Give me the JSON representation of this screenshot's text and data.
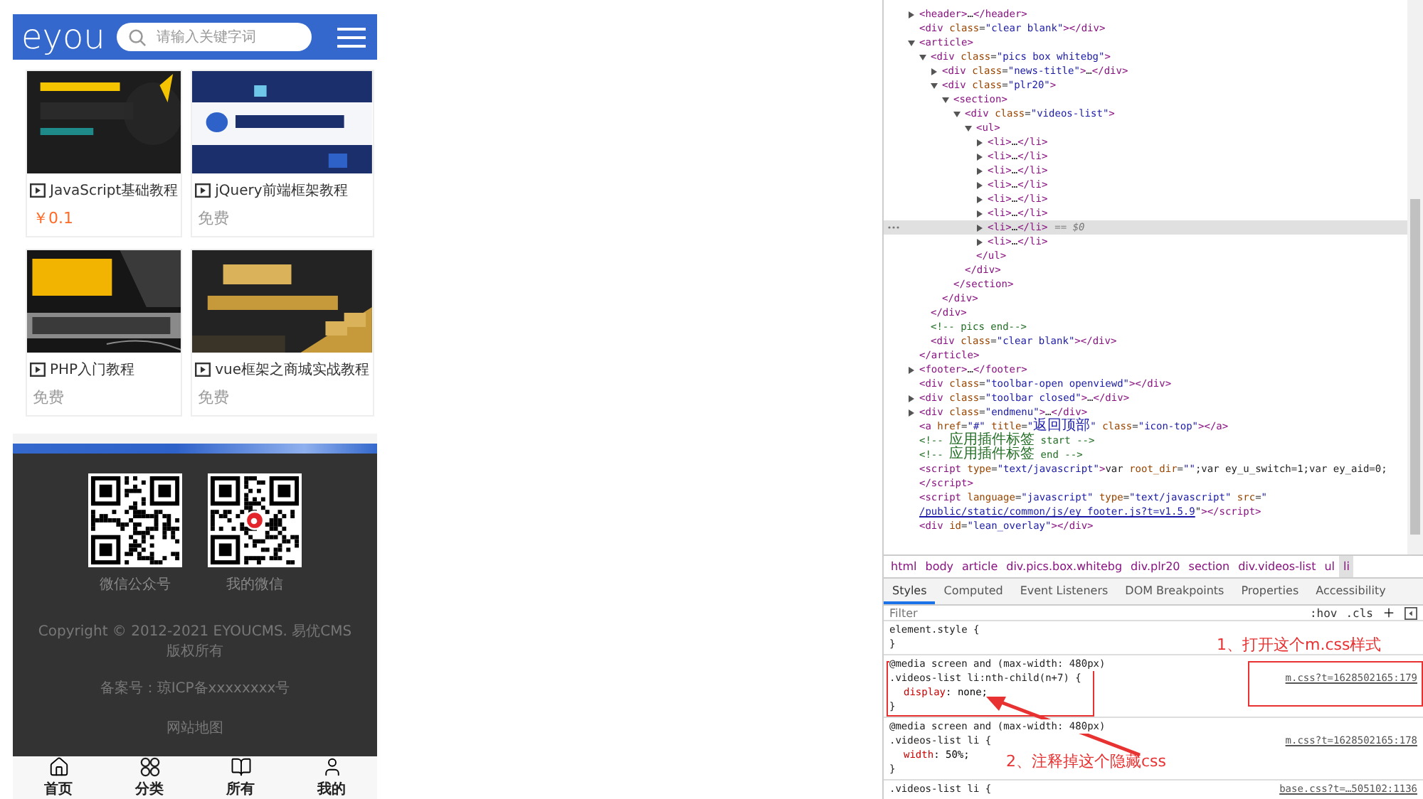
{
  "phone": {
    "logo": "eyou",
    "search": {
      "placeholder": "请输入关键字词"
    },
    "videos": [
      {
        "title": "JavaScript基础教程",
        "price": "￥0.1",
        "kind": "paid"
      },
      {
        "title": "jQuery前端框架教程",
        "price": "免费",
        "kind": "free"
      },
      {
        "title": "PHP入门教程",
        "price": "免费",
        "kind": "free"
      },
      {
        "title": "vue框架之商城实战教程",
        "price": "免费",
        "kind": "free"
      }
    ],
    "footer": {
      "qr_codes": [
        {
          "caption": "微信公众号",
          "badge": false
        },
        {
          "caption": "我的微信",
          "badge": true
        }
      ],
      "copyright": "Copyright © 2012-2021 EYOUCMS. 易优CMS 版权所有",
      "icp": "备案号：琼ICP备xxxxxxxx号",
      "sitemap": "网站地图"
    },
    "tabbar": [
      {
        "label": "首页",
        "kind": "home"
      },
      {
        "label": "分类",
        "kind": "grid"
      },
      {
        "label": "所有",
        "kind": "book"
      },
      {
        "label": "我的",
        "kind": "user"
      }
    ]
  },
  "devtools": {
    "dom_tree": [
      {
        "text": "<header>…</header>",
        "expanded": false
      },
      {
        "text": "<div class=\"clear blank\"></div>"
      },
      {
        "text": "<article>",
        "expanded": true,
        "closing": "</article>",
        "children": [
          {
            "text": "<div class=\"pics box whitebg\">",
            "expanded": true,
            "closing": "</div>",
            "children": [
              {
                "text": "<div class=\"news-title\">…</div>",
                "expanded": false
              },
              {
                "text": "<div class=\"plr20\">",
                "expanded": true,
                "closing": "</div>",
                "children": [
                  {
                    "text": "<section>",
                    "expanded": true,
                    "closing": "</section>",
                    "children": [
                      {
                        "text": "<div class=\"videos-list\">",
                        "expanded": true,
                        "closing": "</div>",
                        "children": [
                          {
                            "text": "<ul>",
                            "expanded": true,
                            "closing": "</ul>",
                            "children": [
                              {
                                "text": "<li>…</li>",
                                "expanded": false,
                                "selected": false
                              },
                              {
                                "text": "<li>…</li>",
                                "expanded": false,
                                "selected": false
                              },
                              {
                                "text": "<li>…</li>",
                                "expanded": false,
                                "selected": false
                              },
                              {
                                "text": "<li>…</li>",
                                "expanded": false,
                                "selected": false
                              },
                              {
                                "text": "<li>…</li>",
                                "expanded": false,
                                "selected": false
                              },
                              {
                                "text": "<li>…</li>",
                                "expanded": false,
                                "selected": false
                              },
                              {
                                "text": "<li>…</li>",
                                "expanded": false,
                                "selected": true,
                                "marker": "== $0"
                              },
                              {
                                "text": "<li>…</li>",
                                "expanded": false,
                                "selected": false
                              }
                            ]
                          }
                        ]
                      }
                    ]
                  }
                ]
              }
            ]
          },
          {
            "text": "<!-- pics end-->"
          },
          {
            "text": "<div class=\"clear blank\"></div>"
          }
        ]
      },
      {
        "text": "<footer>…</footer>",
        "expanded": false
      },
      {
        "text": "<div class=\"toolbar-open openviewd\"></div>"
      },
      {
        "text": "<div class=\"toolbar closed\">…</div>",
        "expanded": false
      },
      {
        "text": "<div class=\"endmenu\">…</div>",
        "expanded": false
      },
      {
        "text": "<a href=\"#\" title=\"返回顶部\" class=\"icon-top\"></a>"
      },
      {
        "text": "<!-- 应用插件标签 start -->"
      },
      {
        "text": "<!-- 应用插件标签 end -->"
      },
      {
        "text": "<script type=\"text/javascript\">var root_dir=\"\";var ey_u_switch=1;var ey_aid=0;"
      },
      {
        "text": "</script>"
      },
      {
        "text": "<script language=\"javascript\" type=\"text/javascript\" src=\"",
        "link": "/public/static/common/js/ey_footer.js?t=v1.5.9",
        "after": "\"></script>"
      },
      {
        "text": "<div id=\"lean_overlay\"></div>"
      }
    ],
    "breadcrumb": [
      {
        "label": "html",
        "selected": false
      },
      {
        "label": "body",
        "selected": false
      },
      {
        "label": "article",
        "selected": false
      },
      {
        "label": "div.pics.box.whitebg",
        "selected": false
      },
      {
        "label": "div.plr20",
        "selected": false
      },
      {
        "label": "section",
        "selected": false
      },
      {
        "label": "div.videos-list",
        "selected": false
      },
      {
        "label": "ul",
        "selected": false
      },
      {
        "label": "li",
        "selected": true
      }
    ],
    "tabs": [
      {
        "label": "Styles",
        "selected": true
      },
      {
        "label": "Computed",
        "selected": false
      },
      {
        "label": "Event Listeners",
        "selected": false
      },
      {
        "label": "DOM Breakpoints",
        "selected": false
      },
      {
        "label": "Properties",
        "selected": false
      },
      {
        "label": "Accessibility",
        "selected": false
      }
    ],
    "filter": {
      "placeholder": "Filter",
      "buttons": [
        ":hov",
        ".cls"
      ]
    },
    "rules": [
      {
        "selector": "element.style {",
        "close": "}"
      },
      {
        "media": "@media screen and (max-width: 480px)",
        "selector": ".videos-list li:nth-child(n+7) {",
        "source": "m.css?t=1628502165:179",
        "declarations": [
          "display: none;"
        ],
        "close": "}"
      },
      {
        "media": "@media screen and (max-width: 480px)",
        "selector": ".videos-list li {",
        "source": "m.css?t=1628502165:178",
        "declarations": [
          "width: 50%;"
        ],
        "close": "}"
      },
      {
        "selector": ".videos-list li {",
        "source": "base.css?t=…505102:1136"
      }
    ],
    "annotations": [
      "1、打开这个m.css样式",
      "2、注释掉这个隐藏css"
    ]
  }
}
